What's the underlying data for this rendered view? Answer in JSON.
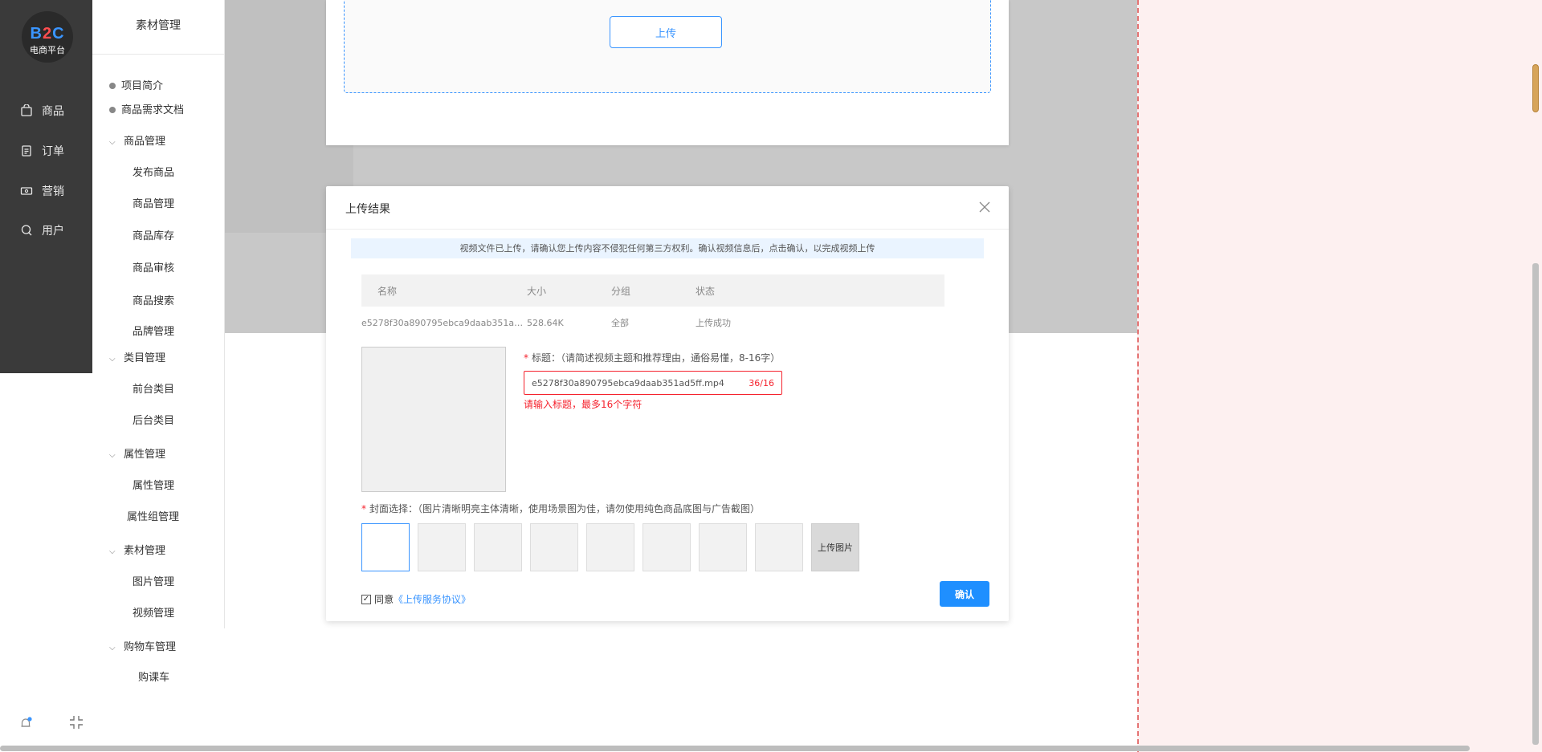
{
  "nav": {
    "logo_main": "B2C",
    "logo_sub": "电商平台",
    "items": [
      {
        "label": "商品",
        "icon": "shopping-bag-icon"
      },
      {
        "label": "订单",
        "icon": "order-list-icon"
      },
      {
        "label": "营销",
        "icon": "ticket-icon"
      },
      {
        "label": "用户",
        "icon": "user-icon"
      }
    ]
  },
  "sidebar": {
    "title": "素材管理",
    "items": [
      {
        "label": "项目简介",
        "kind": "dot"
      },
      {
        "label": "商品需求文档",
        "kind": "dot"
      },
      {
        "label": "商品管理",
        "kind": "group"
      },
      {
        "label": "发布商品",
        "kind": "child"
      },
      {
        "label": "商品管理",
        "kind": "child"
      },
      {
        "label": "商品库存",
        "kind": "child"
      },
      {
        "label": "商品审核",
        "kind": "child"
      },
      {
        "label": "商品搜索",
        "kind": "child"
      },
      {
        "label": "品牌管理",
        "kind": "child"
      },
      {
        "label": "类目管理",
        "kind": "group"
      },
      {
        "label": "前台类目",
        "kind": "child"
      },
      {
        "label": "后台类目",
        "kind": "child"
      },
      {
        "label": "属性管理",
        "kind": "group"
      },
      {
        "label": "属性管理",
        "kind": "child"
      },
      {
        "label": "属性组管理",
        "kind": "child"
      },
      {
        "label": "素材管理",
        "kind": "group"
      },
      {
        "label": "图片管理",
        "kind": "child"
      },
      {
        "label": "视频管理",
        "kind": "child"
      },
      {
        "label": "购物车管理",
        "kind": "group"
      },
      {
        "label": "购课车",
        "kind": "child"
      }
    ]
  },
  "upload": {
    "button_label": "上传"
  },
  "modal": {
    "title": "上传结果",
    "notice": "视频文件已上传，请确认您上传内容不侵犯任何第三方权利。确认视频信息后，点击确认，以完成视频上传",
    "table": {
      "headers": [
        "名称",
        "大小",
        "分组",
        "状态"
      ],
      "rows": [
        [
          "e5278f30a890795ebca9daab351ad5ff.mp4",
          "528.64K",
          "全部",
          "上传成功"
        ]
      ]
    },
    "title_field": {
      "label": "标题：（请简述视频主题和推荐理由，通俗易懂，8-16字）",
      "value": "e5278f30a890795ebca9daab351ad5ff.mp4",
      "count": "36/16",
      "error": "请输入标题，最多16个字符"
    },
    "cover": {
      "label": "封面选择：（图片清晰明亮主体清晰，使用场景图为佳，请勿使用纯色商品底图与广告截图）",
      "upload_label": "上传图片"
    },
    "agree_text": "同意",
    "agree_link": "《上传服务协议》",
    "agree_checked": true,
    "confirm_label": "确认"
  },
  "colors": {
    "accent": "#1f8fff",
    "error": "#f5222d",
    "nav_bg": "#3a3a3a"
  }
}
